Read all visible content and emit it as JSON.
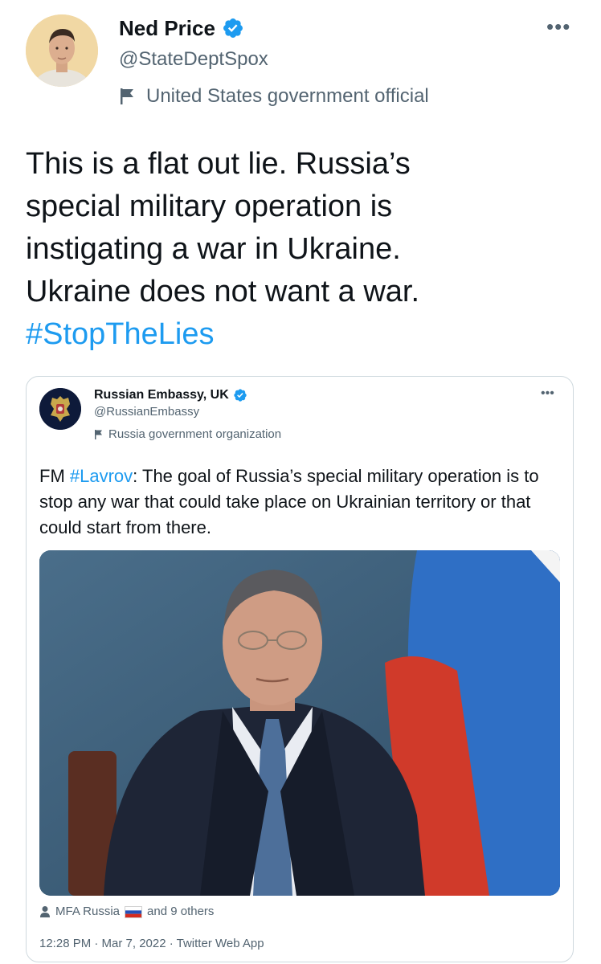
{
  "tweet": {
    "author_name": "Ned Price",
    "author_handle": "@StateDeptSpox",
    "affiliation": "United States government official",
    "text_line1": "This is a flat out lie. Russia’s",
    "text_line2": "special military operation is",
    "text_line3": "instigating a war in Ukraine.",
    "text_line4": "Ukraine does not want a war.",
    "hashtag": "#StopTheLies",
    "more_label": "•••"
  },
  "quoted": {
    "author_name": "Russian Embassy, UK",
    "author_handle": "@RussianEmbassy",
    "affiliation": "Russia government organization",
    "text_prefix": "FM ",
    "hashtag": "#Lavrov",
    "text_rest": ": The goal of Russia’s special military operation is to stop any war that could take place on Ukrainian territory or that could start from there.",
    "tagged_prefix": "MFA Russia",
    "tagged_suffix": "and 9 others",
    "timestamp": "12:28 PM · Mar 7, 2022 · Twitter Web App",
    "more_label": "•••"
  },
  "colors": {
    "accent": "#1d9bf0",
    "text_primary": "#0f1419",
    "text_secondary": "#536471",
    "border": "#cfd9de"
  },
  "icons": {
    "verified": "verified-badge-icon",
    "affiliation": "flag-icon",
    "more": "more-icon",
    "tagged": "person-icon",
    "russia_flag": "russia-flag-icon"
  }
}
